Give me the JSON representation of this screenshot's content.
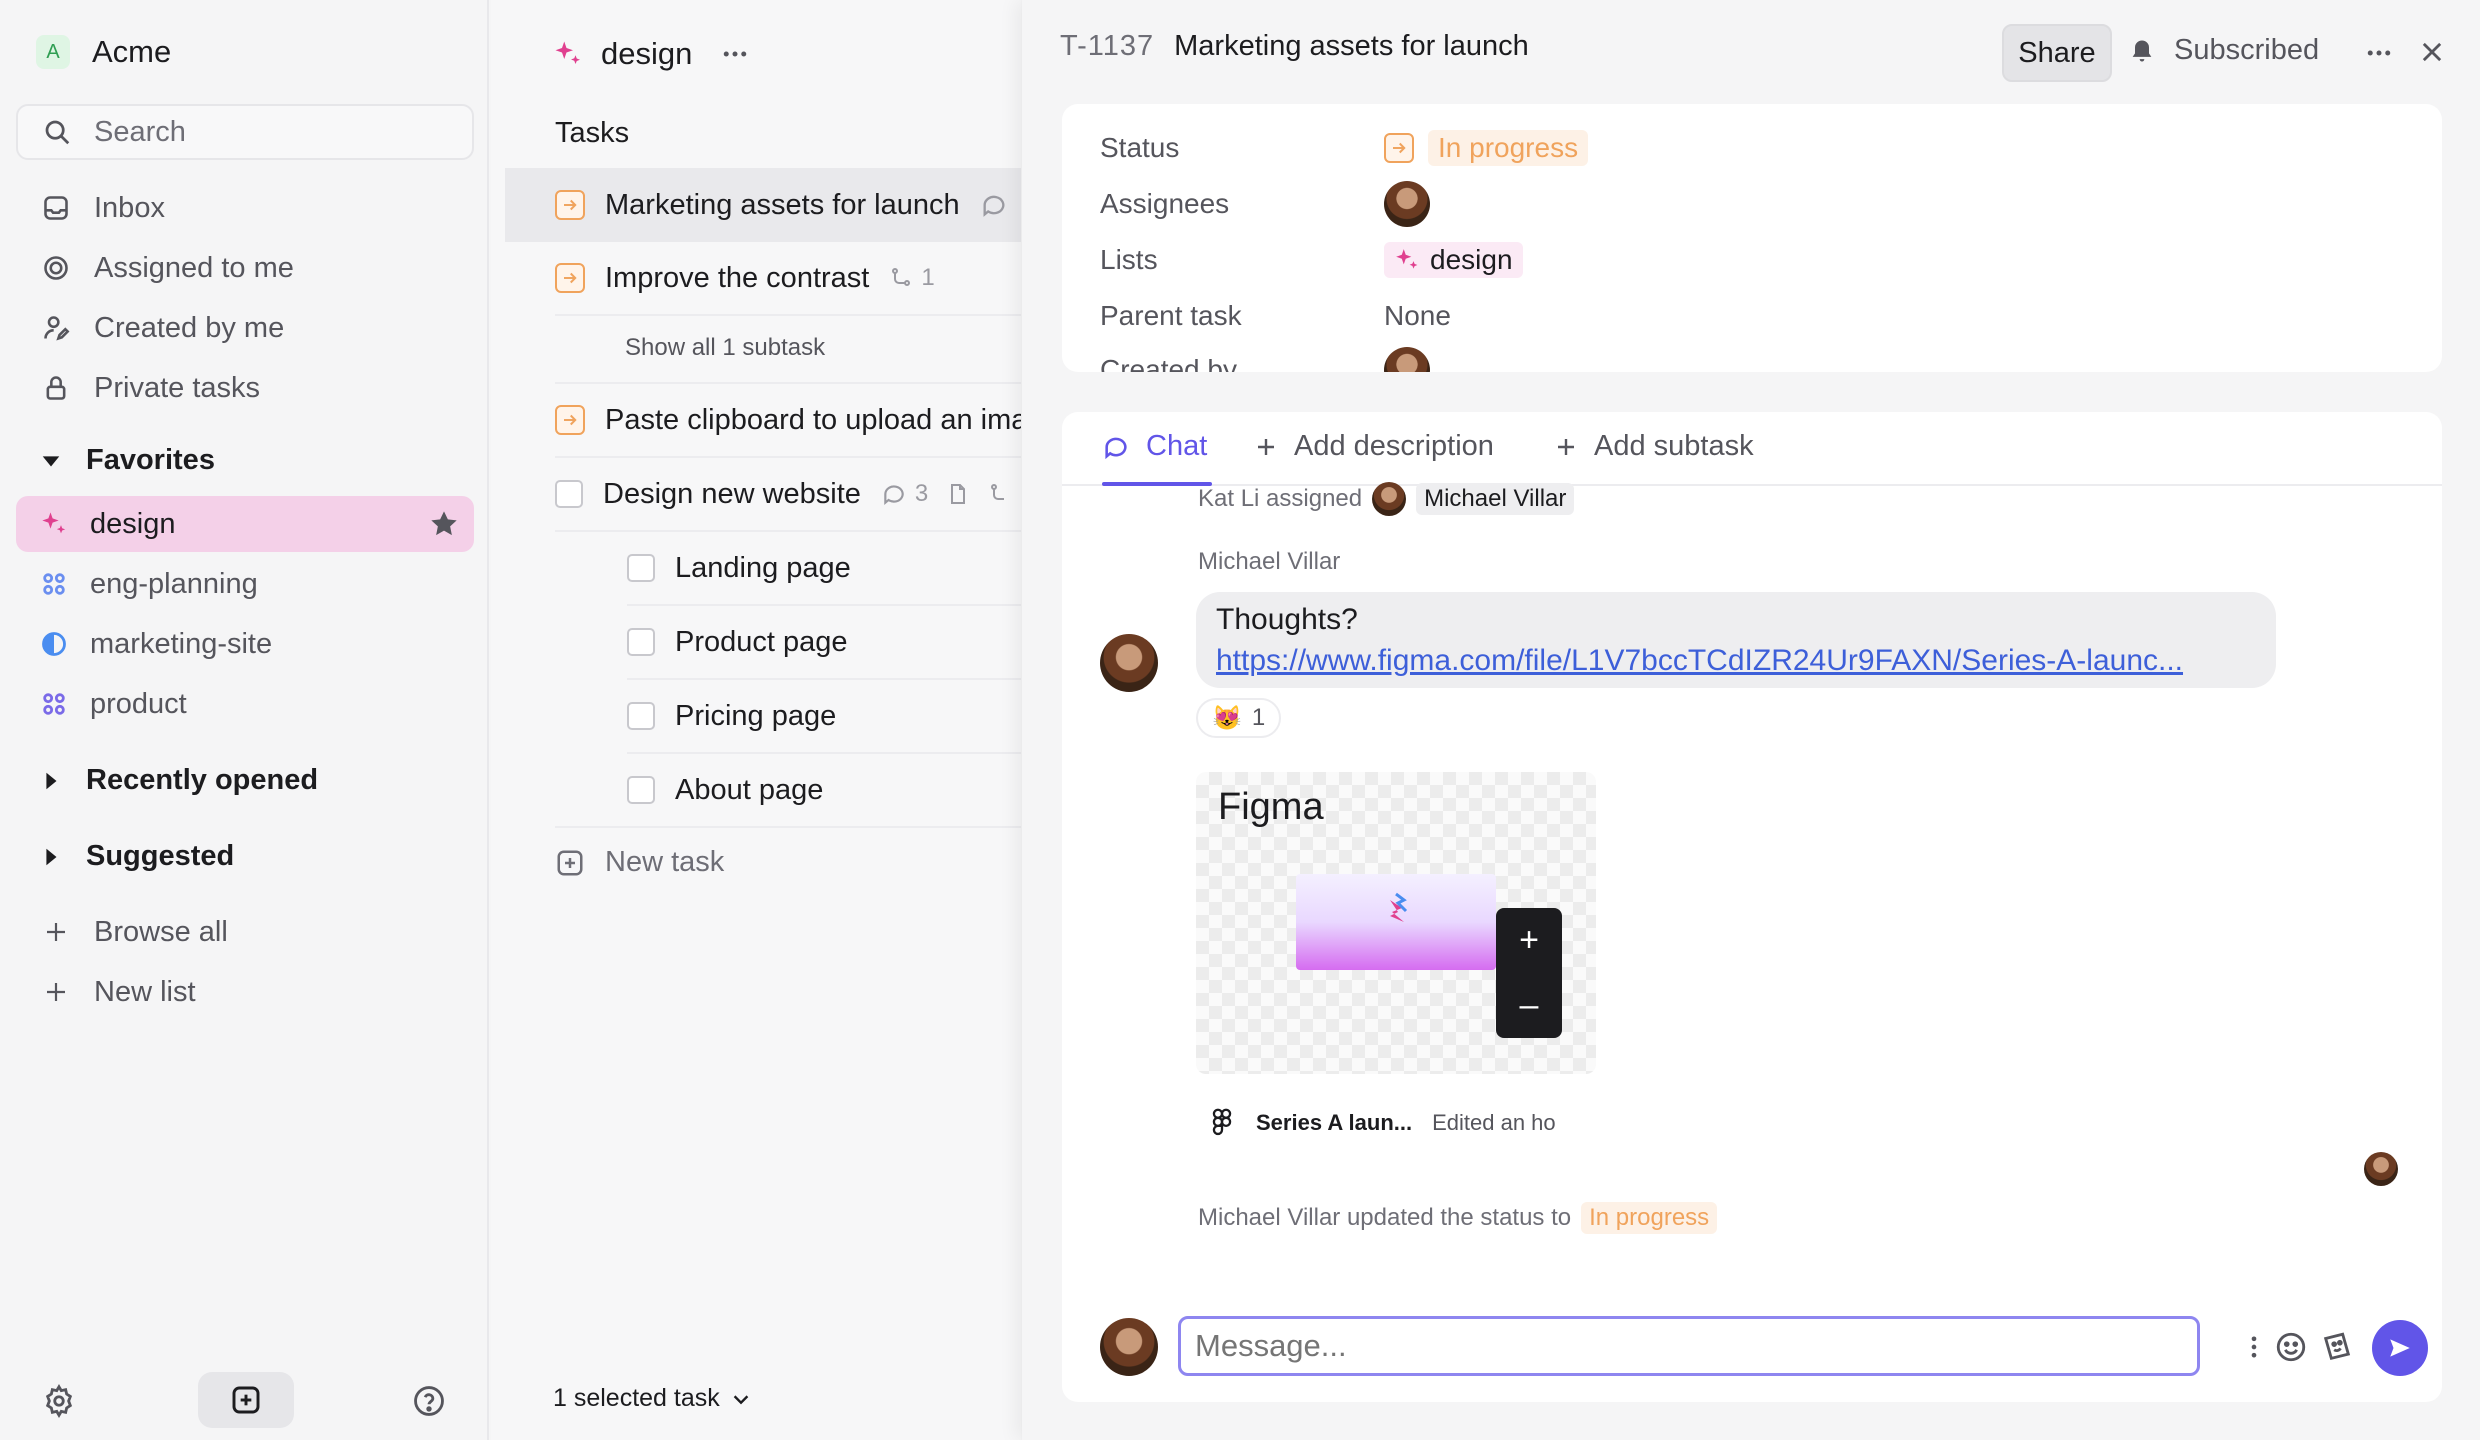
{
  "workspace": {
    "badge": "A",
    "name": "Acme"
  },
  "sidebar": {
    "search_placeholder": "Search",
    "nav": [
      {
        "label": "Inbox",
        "icon": "inbox-icon"
      },
      {
        "label": "Assigned to me",
        "icon": "target-icon"
      },
      {
        "label": "Created by me",
        "icon": "user-pen-icon"
      },
      {
        "label": "Private tasks",
        "icon": "lock-icon"
      }
    ],
    "favorites_label": "Favorites",
    "favorites": [
      {
        "label": "design",
        "icon": "sparkle-icon",
        "color": "#e0408f"
      },
      {
        "label": "eng-planning",
        "icon": "grid-icon",
        "color": "#6a8ef0"
      },
      {
        "label": "marketing-site",
        "icon": "half-circle-icon",
        "color": "#4a8df0"
      },
      {
        "label": "product",
        "icon": "grid-icon",
        "color": "#7a6ae8"
      }
    ],
    "recently_opened_label": "Recently opened",
    "suggested_label": "Suggested",
    "browse_all_label": "Browse all",
    "new_list_label": "New list"
  },
  "list": {
    "title": "design",
    "tasks_label": "Tasks",
    "tasks": [
      {
        "title": "Marketing assets for launch"
      },
      {
        "title": "Improve the contrast",
        "subtask_count": "1"
      },
      {
        "title": "Paste clipboard to upload an ima"
      },
      {
        "title": "Design new website",
        "comment_count": "3"
      }
    ],
    "show_subtasks": "Show all 1 subtask",
    "subtasks": [
      "Landing page",
      "Product page",
      "Pricing page",
      "About page"
    ],
    "new_task_label": "New task",
    "selected_label": "1 selected task"
  },
  "detail": {
    "id": "T-1137",
    "title": "Marketing assets for launch",
    "share_label": "Share",
    "subscribed_label": "Subscribed",
    "props": {
      "status_label": "Status",
      "status_value": "In progress",
      "assignees_label": "Assignees",
      "lists_label": "Lists",
      "lists_value": "design",
      "parent_label": "Parent task",
      "parent_value": "None",
      "created_label": "Created by"
    },
    "tabs": {
      "chat": "Chat",
      "add_description": "Add description",
      "add_subtask": "Add subtask"
    },
    "chat": {
      "assign_event_actor": "Kat Li assigned",
      "assign_event_target": "Michael Villar",
      "message_author": "Michael Villar",
      "message_text": "Thoughts?",
      "message_link": "https://www.figma.com/file/L1V7bccTCdIZR24Ur9FAXN/Series-A-launc...",
      "reaction_emoji": "😻",
      "reaction_count": "1",
      "preview_brand": "Figma",
      "preview_zoom_in": "+",
      "preview_zoom_out": "–",
      "preview_file": "Series A laun...",
      "preview_edited": "Edited an hour ago",
      "status_event_text": "Michael Villar updated the status to",
      "status_event_value": "In progress",
      "composer_placeholder": "Message..."
    }
  },
  "colors": {
    "accent": "#6155e8",
    "in_progress": "#f0a35c",
    "favorite_active_bg": "#f4d0e8"
  }
}
